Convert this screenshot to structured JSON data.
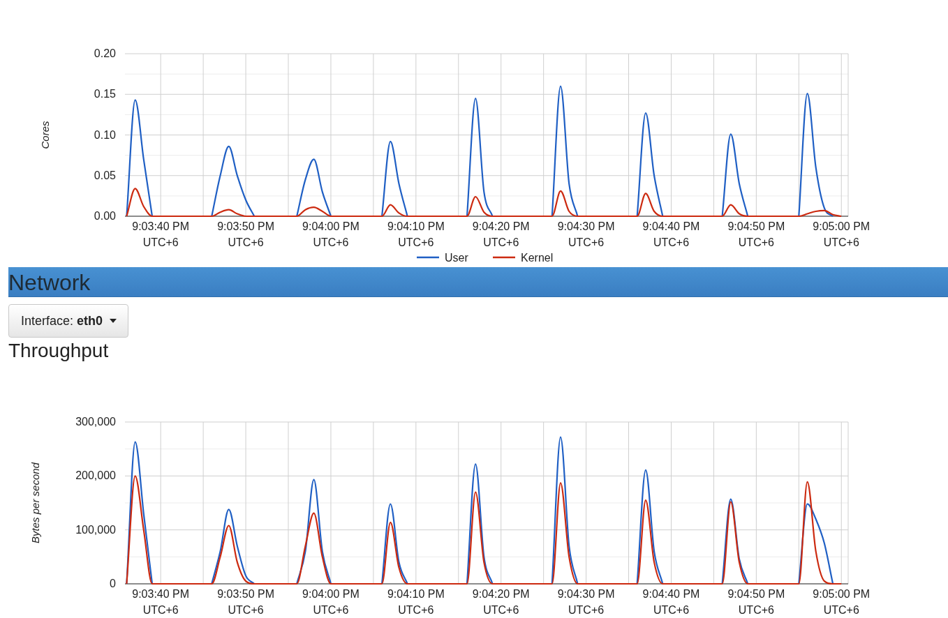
{
  "cpu": {
    "chart_data": {
      "type": "line",
      "ylabel": "Cores",
      "categories": [
        null,
        null,
        null,
        null,
        "9:03:40 PM\nUTC+6",
        null,
        null,
        null,
        null,
        null,
        null,
        null,
        null,
        null,
        "9:03:50 PM\nUTC+6",
        null,
        null,
        null,
        null,
        null,
        null,
        null,
        null,
        null,
        "9:04:00 PM\nUTC+6",
        null,
        null,
        null,
        null,
        null,
        null,
        null,
        null,
        null,
        "9:04:10 PM\nUTC+6",
        null,
        null,
        null,
        null,
        null,
        null,
        null,
        null,
        null,
        "9:04:20 PM\nUTC+6",
        null,
        null,
        null,
        null,
        null,
        null,
        null,
        null,
        null,
        "9:04:30 PM\nUTC+6",
        null,
        null,
        null,
        null,
        null,
        null,
        null,
        null,
        null,
        "9:04:40 PM\nUTC+6",
        null,
        null,
        null,
        null,
        null,
        null,
        null,
        null,
        null,
        "9:04:50 PM\nUTC+6",
        null,
        null,
        null,
        null,
        null,
        null,
        null,
        null,
        null,
        "9:05:00 PM\nUTC+6"
      ],
      "series": [
        {
          "name": "User",
          "color": "#1f5fc4",
          "values": [
            0,
            0.143,
            0.07,
            0,
            null,
            null,
            null,
            null,
            null,
            null,
            0,
            0.05,
            0.086,
            0.05,
            0.02,
            0,
            null,
            null,
            null,
            null,
            0,
            0.045,
            0.07,
            0.03,
            0,
            null,
            null,
            null,
            null,
            null,
            0,
            0.092,
            0.04,
            0,
            null,
            null,
            null,
            null,
            null,
            null,
            0,
            0.145,
            0.03,
            0,
            null,
            null,
            null,
            null,
            null,
            null,
            0,
            0.16,
            0.04,
            0,
            null,
            null,
            null,
            null,
            null,
            null,
            0,
            0.127,
            0.05,
            0,
            null,
            null,
            null,
            null,
            null,
            null,
            0,
            0.101,
            0.04,
            0,
            null,
            null,
            null,
            null,
            null,
            0,
            0.151,
            0.06,
            0.01,
            0,
            null
          ]
        },
        {
          "name": "Kernel",
          "color": "#cc2a10",
          "values": [
            0,
            0.034,
            0.012,
            0,
            0,
            0,
            0,
            0,
            0,
            0,
            0,
            0.005,
            0.008,
            0.003,
            0,
            0,
            0,
            0,
            0,
            0,
            0,
            0.008,
            0.011,
            0.006,
            0,
            0,
            0,
            0,
            0,
            0,
            0,
            0.014,
            0.004,
            0,
            0,
            0,
            0,
            0,
            0,
            0,
            0,
            0.024,
            0.005,
            0,
            0,
            0,
            0,
            0,
            0,
            0,
            0,
            0.031,
            0.006,
            0,
            0,
            0,
            0,
            0,
            0,
            0,
            0,
            0.028,
            0.006,
            0,
            0,
            0,
            0,
            0,
            0,
            0,
            0,
            0.014,
            0.003,
            0,
            0,
            0,
            0,
            0,
            0,
            0,
            0.003,
            0.006,
            0.007,
            0.002,
            0
          ]
        }
      ],
      "ylim": [
        0,
        0.2
      ],
      "grid": true,
      "legend": true,
      "yticks": [
        {
          "value": 0,
          "label": "0.00"
        },
        {
          "value": 0.05,
          "label": "0.05"
        },
        {
          "value": 0.1,
          "label": "0.10"
        },
        {
          "value": 0.15,
          "label": "0.15"
        },
        {
          "value": 0.2,
          "label": "0.20"
        }
      ]
    }
  },
  "network": {
    "title": "Network",
    "interface_button": {
      "label": "Interface: **eth0**"
    },
    "throughput": {
      "title": "Throughput",
      "chart_data": {
        "type": "line",
        "ylabel": "Bytes per second",
        "categories": [
          null,
          null,
          null,
          null,
          "9:03:40 PM\nUTC+6",
          null,
          null,
          null,
          null,
          null,
          null,
          null,
          null,
          null,
          "9:03:50 PM\nUTC+6",
          null,
          null,
          null,
          null,
          null,
          null,
          null,
          null,
          null,
          "9:04:00 PM\nUTC+6",
          null,
          null,
          null,
          null,
          null,
          null,
          null,
          null,
          null,
          "9:04:10 PM\nUTC+6",
          null,
          null,
          null,
          null,
          null,
          null,
          null,
          null,
          null,
          "9:04:20 PM\nUTC+6",
          null,
          null,
          null,
          null,
          null,
          null,
          null,
          null,
          null,
          "9:04:30 PM\nUTC+6",
          null,
          null,
          null,
          null,
          null,
          null,
          null,
          null,
          null,
          "9:04:40 PM\nUTC+6",
          null,
          null,
          null,
          null,
          null,
          null,
          null,
          null,
          null,
          "9:04:50 PM\nUTC+6",
          null,
          null,
          null,
          null,
          null,
          null,
          null,
          null,
          null,
          "9:05:00 PM\nUTC+6"
        ],
        "series": [
          {
            "color": "#1f5fc4",
            "values": [
              0,
              263000,
              130000,
              0,
              null,
              null,
              null,
              null,
              null,
              null,
              0,
              60000,
              138000,
              70000,
              15000,
              0,
              null,
              null,
              null,
              null,
              0,
              60000,
              193000,
              60000,
              0,
              null,
              null,
              null,
              null,
              null,
              0,
              148000,
              40000,
              0,
              null,
              null,
              null,
              null,
              null,
              null,
              0,
              222000,
              50000,
              0,
              null,
              null,
              null,
              null,
              null,
              null,
              0,
              272000,
              70000,
              0,
              null,
              null,
              null,
              null,
              null,
              null,
              0,
              211000,
              60000,
              0,
              null,
              null,
              null,
              null,
              null,
              null,
              0,
              157000,
              46000,
              0,
              null,
              null,
              null,
              null,
              null,
              0,
              148000,
              120000,
              75000,
              0,
              null
            ]
          },
          {
            "color": "#cc2a10",
            "values": [
              0,
              200000,
              100000,
              0,
              0,
              0,
              0,
              0,
              0,
              0,
              0,
              50000,
              108000,
              40000,
              5000,
              0,
              0,
              0,
              0,
              0,
              0,
              70000,
              131000,
              50000,
              0,
              0,
              0,
              0,
              0,
              0,
              0,
              114000,
              30000,
              0,
              0,
              0,
              0,
              0,
              0,
              0,
              0,
              170000,
              40000,
              0,
              0,
              0,
              0,
              0,
              0,
              0,
              0,
              187000,
              50000,
              0,
              0,
              0,
              0,
              0,
              0,
              0,
              0,
              155000,
              40000,
              0,
              0,
              0,
              0,
              0,
              0,
              0,
              0,
              152000,
              40000,
              0,
              0,
              0,
              0,
              0,
              0,
              0,
              189000,
              60000,
              5000,
              0,
              0
            ]
          }
        ],
        "ylim": [
          0,
          300000
        ],
        "grid": true,
        "yticks": [
          {
            "value": 0,
            "label": "0"
          },
          {
            "value": 100000,
            "label": "100,000"
          },
          {
            "value": 200000,
            "label": "200,000"
          },
          {
            "value": 300000,
            "label": "300,000"
          }
        ]
      }
    }
  }
}
